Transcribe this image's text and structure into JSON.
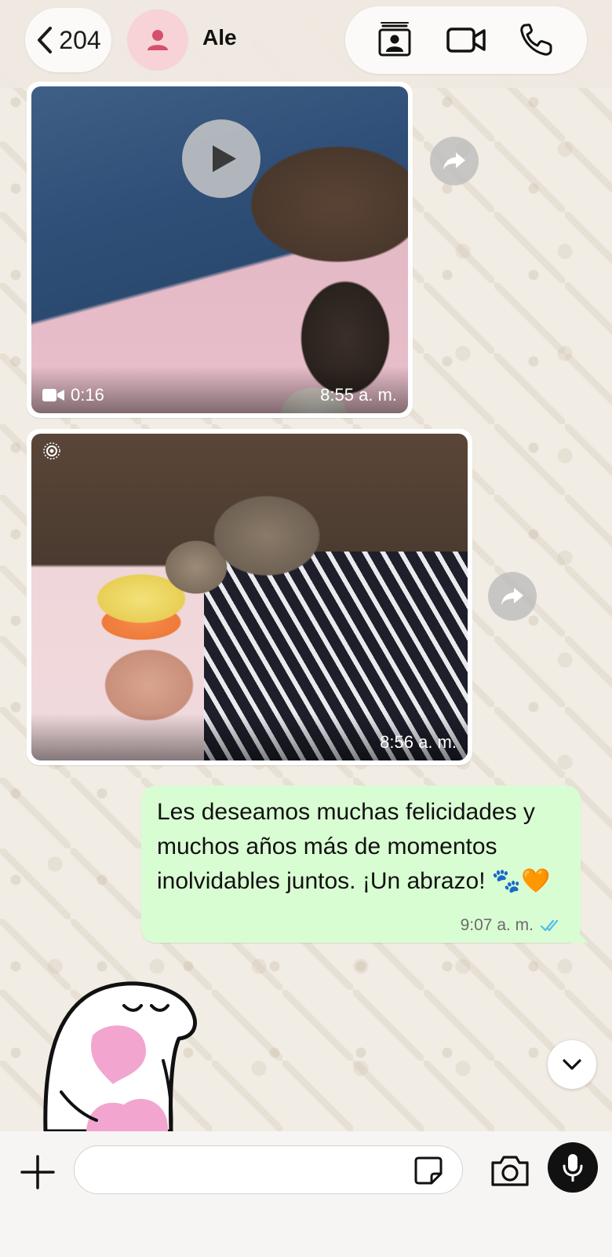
{
  "header": {
    "back_count": "204",
    "contact_name": "Ale",
    "icons": [
      "contact-card-icon",
      "video-call-icon",
      "voice-call-icon"
    ]
  },
  "messages": {
    "video": {
      "duration": "0:16",
      "time": "8:55 a. m."
    },
    "photo": {
      "time": "8:56 a. m."
    },
    "text": {
      "body": "Les deseamos muchas felicidades y muchos años más de momentos inolvidables juntos. ¡Un abrazo! 🐾🧡",
      "time": "9:07 a. m.",
      "status": "read"
    }
  },
  "composer": {
    "placeholder": "",
    "icons": [
      "plus-icon",
      "sticker-icon",
      "camera-icon",
      "microphone-icon"
    ]
  },
  "colors": {
    "outgoing_bubble": "#d9fdd3",
    "read_ticks": "#53bdeb",
    "avatar_bg": "#f7d3d8",
    "avatar_icon": "#d6506b"
  }
}
